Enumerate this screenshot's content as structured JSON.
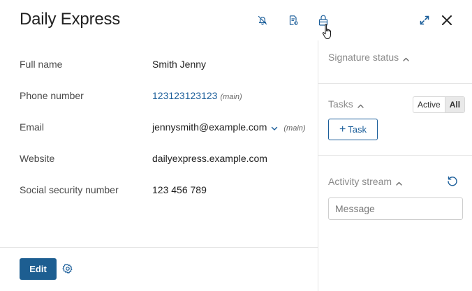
{
  "header": {
    "title": "Daily Express",
    "icons": [
      "bell-off-icon",
      "document-icon",
      "lock-icon",
      "expand-icon",
      "close-icon"
    ]
  },
  "fields": [
    {
      "label": "Full name",
      "value": "Smith Jenny"
    },
    {
      "label": "Phone number",
      "value": "123123123123",
      "tag": "(main)"
    },
    {
      "label": "Email",
      "value": "jennysmith@example.com",
      "tag": "(main)"
    },
    {
      "label": "Website",
      "value": "dailyexpress.example.com"
    },
    {
      "label": "Social security number",
      "value": "123 456 789"
    }
  ],
  "footer": {
    "edit_label": "Edit"
  },
  "sidebar": {
    "signature_title": "Signature status",
    "tasks_title": "Tasks",
    "filter_active": "Active",
    "filter_all": "All",
    "filter_selected": "All",
    "add_task_label": "Task",
    "activity_title": "Activity stream",
    "message_placeholder": "Message"
  },
  "colors": {
    "accent": "#1d5e91",
    "link": "#1b5e9a",
    "border": "#e4e4e4"
  }
}
